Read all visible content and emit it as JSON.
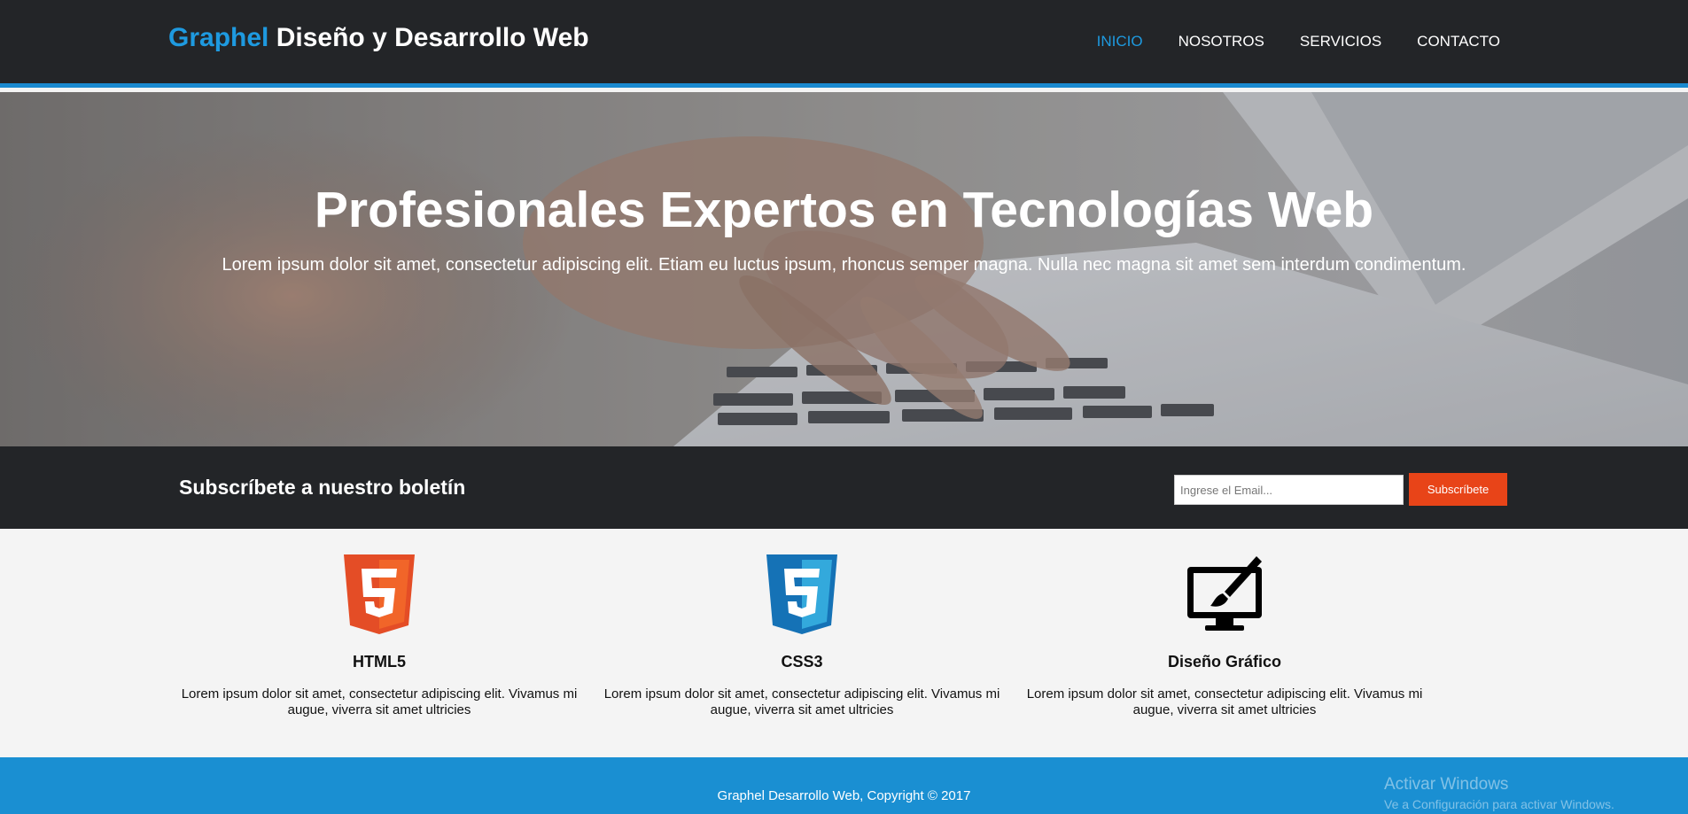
{
  "header": {
    "brand_highlight": "Graphel",
    "brand_rest": " Diseño y Desarrollo Web",
    "nav": [
      {
        "label": "INICIO"
      },
      {
        "label": "NOSOTROS"
      },
      {
        "label": "SERVICIOS"
      },
      {
        "label": "CONTACTO"
      }
    ]
  },
  "hero": {
    "title": "Profesionales Expertos en Tecnologías Web",
    "subtitle": "Lorem ipsum dolor sit amet, consectetur adipiscing elit. Etiam eu luctus ipsum, rhoncus semper magna. Nulla nec magna sit amet sem interdum condimentum."
  },
  "newsletter": {
    "title": "Subscríbete a nuestro boletín",
    "email_placeholder": "Ingrese el Email...",
    "button_label": "Subscríbete"
  },
  "features": [
    {
      "icon": "html5-icon",
      "title": "HTML5",
      "text": "Lorem ipsum dolor sit amet, consectetur adipiscing elit. Vivamus mi augue, viverra sit amet ultricies"
    },
    {
      "icon": "css3-icon",
      "title": "CSS3",
      "text": "Lorem ipsum dolor sit amet, consectetur adipiscing elit. Vivamus mi augue, viverra sit amet ultricies"
    },
    {
      "icon": "monitor-brush-icon",
      "title": "Diseño Gráfico",
      "text": "Lorem ipsum dolor sit amet, consectetur adipiscing elit. Vivamus mi augue, viverra sit amet ultricies"
    }
  ],
  "footer": {
    "copyright": "Graphel Desarrollo Web, Copyright © 2017"
  },
  "windows_watermark": {
    "title": "Activar Windows",
    "subtitle": "Ve a Configuración para activar Windows."
  },
  "colors": {
    "accent": "#1a8ad0",
    "header_bg": "#232528",
    "cta": "#e84418",
    "html5": "#e44d26",
    "css3": "#1572b6"
  }
}
